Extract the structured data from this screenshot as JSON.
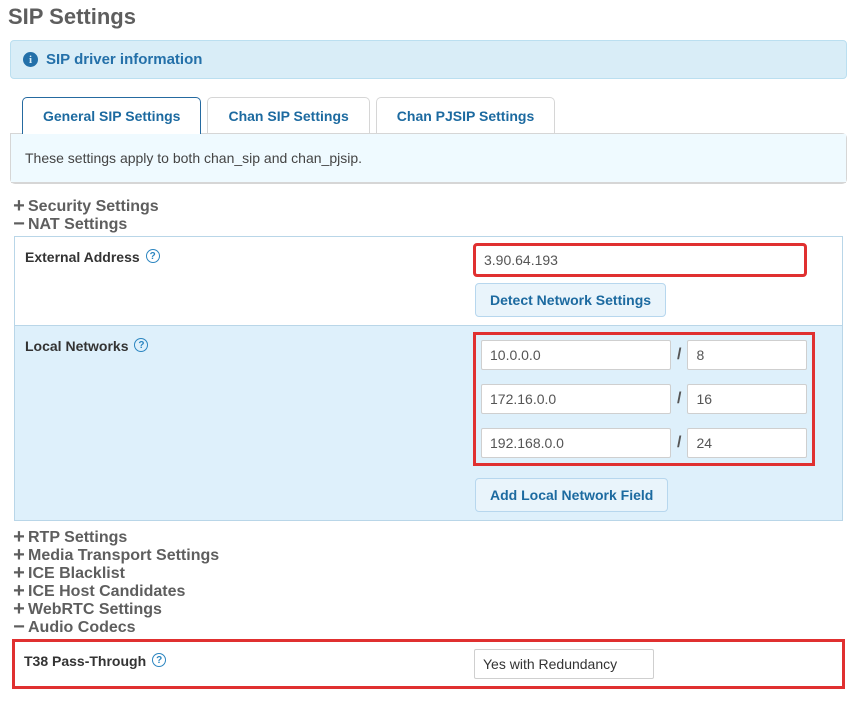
{
  "page_title": "SIP Settings",
  "banner": {
    "text": "SIP driver information"
  },
  "tabs": {
    "general": "General SIP Settings",
    "chan_sip": "Chan SIP Settings",
    "chan_pjsip": "Chan PJSIP Settings"
  },
  "panel_note": "These settings apply to both chan_sip and chan_pjsip.",
  "sections": {
    "security": "Security Settings",
    "nat": "NAT Settings",
    "rtp": "RTP Settings",
    "media_transport": "Media Transport Settings",
    "ice_blacklist": "ICE Blacklist",
    "ice_host": "ICE Host Candidates",
    "webrtc": "WebRTC Settings",
    "audio_codecs": "Audio Codecs"
  },
  "nat": {
    "external_label": "External Address",
    "external_value": "3.90.64.193",
    "detect_btn": "Detect Network Settings",
    "local_label": "Local Networks",
    "local_networks": [
      {
        "net": "10.0.0.0",
        "mask": "8"
      },
      {
        "net": "172.16.0.0",
        "mask": "16"
      },
      {
        "net": "192.168.0.0",
        "mask": "24"
      }
    ],
    "add_local_btn": "Add Local Network Field"
  },
  "t38": {
    "label": "T38 Pass-Through",
    "value": "Yes with Redundancy"
  }
}
